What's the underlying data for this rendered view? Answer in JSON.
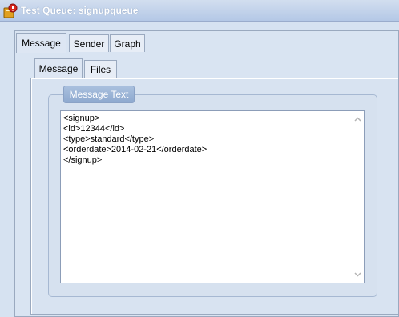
{
  "window": {
    "title": "Test Queue: signupqueue"
  },
  "outer_tabs": [
    {
      "label": "Message",
      "active": true
    },
    {
      "label": "Sender",
      "active": false
    },
    {
      "label": "Graph",
      "active": false
    }
  ],
  "inner_tabs": [
    {
      "label": "Message",
      "active": true
    },
    {
      "label": "Files",
      "active": false
    }
  ],
  "message_group": {
    "label": "Message Text",
    "text": "<signup>\n<id>12344</id>\n<type>standard</type>\n<orderdate>2014-02-21</orderdate>\n</signup>"
  },
  "icons": {
    "title_icon": "queue-app-icon",
    "scroll_up": "scroll-up-arrow-icon",
    "scroll_down": "scroll-down-arrow-icon"
  }
}
